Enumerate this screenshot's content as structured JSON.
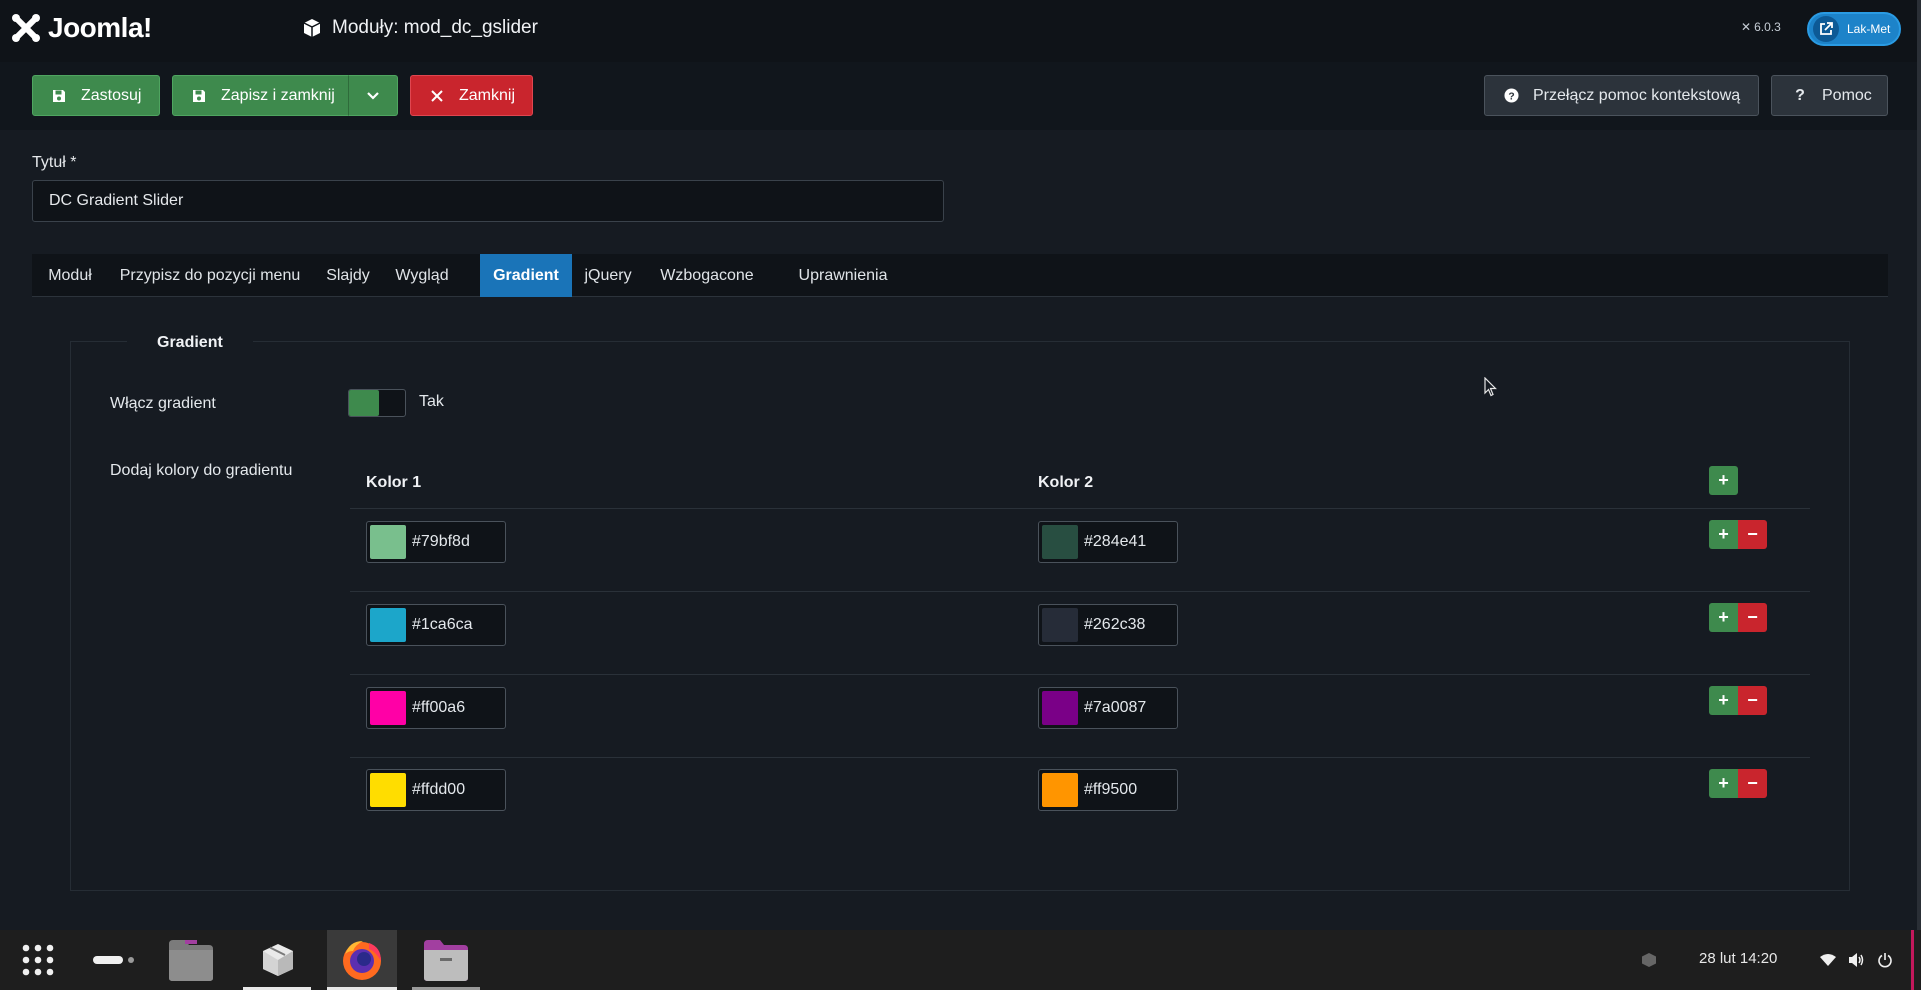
{
  "header": {
    "brand": "Joomla!",
    "title": "Moduły: mod_dc_gslider",
    "version": "6.0.3",
    "user": "Lak-Met"
  },
  "toolbar": {
    "apply": "Zastosuj",
    "save_close": "Zapisz i zamknij",
    "close": "Zamknij",
    "toggle_help": "Przełącz pomoc kontekstową",
    "help": "Pomoc"
  },
  "form": {
    "title_label": "Tytuł *",
    "title_value": "DC Gradient Slider"
  },
  "tabs": [
    {
      "label": "Moduł"
    },
    {
      "label": "Przypisz do pozycji menu"
    },
    {
      "label": "Slajdy"
    },
    {
      "label": "Wygląd"
    },
    {
      "label": "Gradient"
    },
    {
      "label": "jQuery"
    },
    {
      "label": "Wzbogacone"
    },
    {
      "label": "Uprawnienia"
    }
  ],
  "gradient": {
    "legend": "Gradient",
    "enable_label": "Włącz gradient",
    "enable_value": "Tak",
    "colors_label": "Dodaj kolory do gradientu",
    "col1_header": "Kolor 1",
    "col2_header": "Kolor 2",
    "rows": [
      {
        "c1": "#79bf8d",
        "c2": "#284e41"
      },
      {
        "c1": "#1ca6ca",
        "c2": "#262c38"
      },
      {
        "c1": "#ff00a6",
        "c2": "#7a0087"
      },
      {
        "c1": "#ffdd00",
        "c2": "#ff9500"
      }
    ]
  },
  "taskbar": {
    "clock": "28 lut  14:20"
  },
  "colors": {
    "green": "#3e8a4d",
    "red": "#c9252d",
    "blue": "#1a74b8"
  }
}
